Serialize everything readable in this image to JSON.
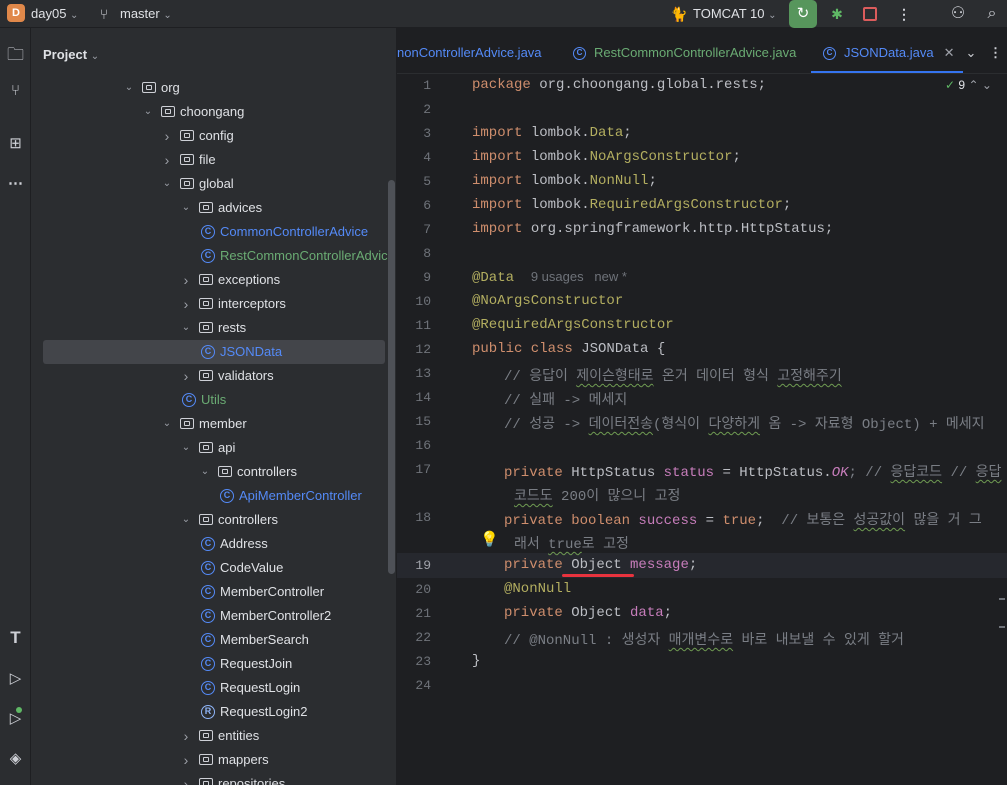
{
  "toolbar": {
    "project_initial": "D",
    "project_name": "day05",
    "branch": "master",
    "run_config": "TOMCAT 10",
    "brand_color": "#e0884a",
    "run_color": "#57965c",
    "stop_color": "#db5c5c"
  },
  "project_panel": {
    "title": "Project",
    "tree": [
      {
        "label": "org",
        "type": "folder",
        "depth": 0,
        "expanded": true
      },
      {
        "label": "choongang",
        "type": "folder",
        "depth": 1,
        "expanded": true
      },
      {
        "label": "config",
        "type": "folder",
        "depth": 2,
        "expanded": false
      },
      {
        "label": "file",
        "type": "folder",
        "depth": 2,
        "expanded": false
      },
      {
        "label": "global",
        "type": "folder",
        "depth": 2,
        "expanded": true
      },
      {
        "label": "advices",
        "type": "folder",
        "depth": 3,
        "expanded": true
      },
      {
        "label": "CommonControllerAdvice",
        "type": "class",
        "depth": 4,
        "color": "blue"
      },
      {
        "label": "RestCommonControllerAdvice",
        "type": "class",
        "depth": 4,
        "color": "green"
      },
      {
        "label": "exceptions",
        "type": "folder",
        "depth": 3,
        "expanded": false
      },
      {
        "label": "interceptors",
        "type": "folder",
        "depth": 3,
        "expanded": false
      },
      {
        "label": "rests",
        "type": "folder",
        "depth": 3,
        "expanded": true
      },
      {
        "label": "JSONData",
        "type": "class",
        "depth": 4,
        "color": "blue",
        "selected": true
      },
      {
        "label": "validators",
        "type": "folder",
        "depth": 3,
        "expanded": false
      },
      {
        "label": "Utils",
        "type": "class",
        "depth": 3,
        "color": "green"
      },
      {
        "label": "member",
        "type": "folder",
        "depth": 2,
        "expanded": true
      },
      {
        "label": "api",
        "type": "folder",
        "depth": 3,
        "expanded": true
      },
      {
        "label": "controllers",
        "type": "folder",
        "depth": 4,
        "expanded": true
      },
      {
        "label": "ApiMemberController",
        "type": "class",
        "depth": 5,
        "color": "blue"
      },
      {
        "label": "controllers",
        "type": "folder",
        "depth": 3,
        "expanded": true
      },
      {
        "label": "Address",
        "type": "class",
        "depth": 4,
        "color": "default"
      },
      {
        "label": "CodeValue",
        "type": "class",
        "depth": 4,
        "color": "default"
      },
      {
        "label": "MemberController",
        "type": "class",
        "depth": 4,
        "color": "default"
      },
      {
        "label": "MemberController2",
        "type": "class",
        "depth": 4,
        "color": "default"
      },
      {
        "label": "MemberSearch",
        "type": "class",
        "depth": 4,
        "color": "default"
      },
      {
        "label": "RequestJoin",
        "type": "class",
        "depth": 4,
        "color": "default"
      },
      {
        "label": "RequestLogin",
        "type": "class",
        "depth": 4,
        "color": "default"
      },
      {
        "label": "RequestLogin2",
        "type": "record",
        "depth": 4,
        "color": "default"
      },
      {
        "label": "entities",
        "type": "folder",
        "depth": 3,
        "expanded": false
      },
      {
        "label": "mappers",
        "type": "folder",
        "depth": 3,
        "expanded": false
      },
      {
        "label": "repositories",
        "type": "folder",
        "depth": 3,
        "expanded": false
      }
    ]
  },
  "editor": {
    "tabs": [
      {
        "label": "nonControllerAdvice.java",
        "active": false,
        "icon": false
      },
      {
        "label": "RestCommonControllerAdvice.java",
        "active": false,
        "icon": true
      },
      {
        "label": "JSONData.java",
        "active": true,
        "icon": true
      }
    ],
    "inspection_count": "9",
    "current_line": 19,
    "line_numbers": [
      "1",
      "2",
      "3",
      "4",
      "5",
      "6",
      "7",
      "8",
      "9",
      "10",
      "11",
      "12",
      "13",
      "14",
      "15",
      "16",
      "17",
      "",
      "18",
      "",
      "19",
      "20",
      "21",
      "22",
      "23",
      "24"
    ],
    "code": {
      "l1_kw": "package",
      "l1_rest": " org.choongang.global.rests;",
      "imp": "import",
      "l3_pkg": " lombok.",
      "l3_cls": "Data",
      "l4_cls": "NoArgsConstructor",
      "l5_cls": "NonNull",
      "l6_cls": "RequiredArgsConstructor",
      "l7_rest": " org.springframework.http.HttpStatus;",
      "semi": ";",
      "l9_ann": "@Data",
      "l9_hint": "9 usages   new *",
      "l10_ann": "@NoArgsConstructor",
      "l11_ann": "@RequiredArgsConstructor",
      "l12_kw": "public class",
      "l12_rest": " JSONData {",
      "l13_a": "// 응답이 ",
      "l13_b": "제이슨형태로",
      "l13_c": " 온거 데이터 형식 ",
      "l13_d": "고정해주기",
      "l14": "// 실패 -> 메세지",
      "l15_a": "// 성공 -> ",
      "l15_b": "데이터전송",
      "l15_c": "(형식이 ",
      "l15_d": "다양하게",
      "l15_e": " 옴 -> 자료형 Object) + 메세지",
      "private": "private",
      "l17_type": " HttpStatus ",
      "l17_field": "status",
      "l17_eq": " = HttpStatus.",
      "l17_const": "OK",
      "l17_c1": "; // ",
      "l17_c2": "응답코드",
      "l17_c3": " // ",
      "l17_c4": "응답",
      "l17w_a": "코드도",
      "l17w_b": " 200이 많으니 고정",
      "l18_kw": "private boolean",
      "l18_field": " success",
      "l18_eq": " = ",
      "l18_true": "true",
      "l18_semi": ";  ",
      "l18_c1": "// 보통은 ",
      "l18_c2": "성공값이",
      "l18_c3": " 많을 거 그",
      "l18w_a": "래서 ",
      "l18w_b": "true",
      "l18w_c": "로 고정",
      "l19_type": " Object ",
      "l19_field": "message",
      "l20_ann": "@NonNull",
      "l21_type": " Object ",
      "l21_field": "data",
      "l22_a": "// @NonNull : 생성자 ",
      "l22_b": "매개변수로",
      "l22_c": " 바로 내보낼 수 있게 할거",
      "l23": "}"
    }
  }
}
